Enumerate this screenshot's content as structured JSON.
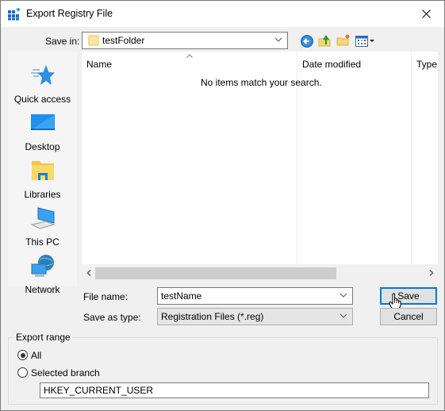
{
  "window": {
    "title": "Export Registry File",
    "title_icon": "registry-icon",
    "close_icon": "close-icon"
  },
  "save_in": {
    "label": "Save in:",
    "value": "testFolder",
    "folder_icon": "folder-icon"
  },
  "toolbar": {
    "icons": [
      "back-icon",
      "up-folder-icon",
      "new-folder-icon",
      "view-menu-icon"
    ]
  },
  "places": [
    {
      "label": "Quick access",
      "icon": "star-icon"
    },
    {
      "label": "Desktop",
      "icon": "desktop-icon"
    },
    {
      "label": "Libraries",
      "icon": "libraries-icon"
    },
    {
      "label": "This PC",
      "icon": "computer-icon"
    },
    {
      "label": "Network",
      "icon": "network-icon"
    }
  ],
  "list": {
    "columns": [
      "Name",
      "Date modified",
      "Type"
    ],
    "sorted_column": "Name",
    "empty_message": "No items match your search."
  },
  "form": {
    "file_name_label": "File name:",
    "file_name_value": "testName",
    "save_type_label": "Save as type:",
    "save_type_value": "Registration Files (*.reg)",
    "save_button": "Save",
    "cancel_button": "Cancel"
  },
  "export_range": {
    "legend": "Export range",
    "options": [
      {
        "label": "All",
        "checked": true
      },
      {
        "label": "Selected branch",
        "checked": false
      }
    ],
    "branch_value": "HKEY_CURRENT_USER"
  },
  "colors": {
    "accent": "#0078d7",
    "window_bg": "#f0f0f0",
    "places_bg": "#f5f5f5"
  }
}
